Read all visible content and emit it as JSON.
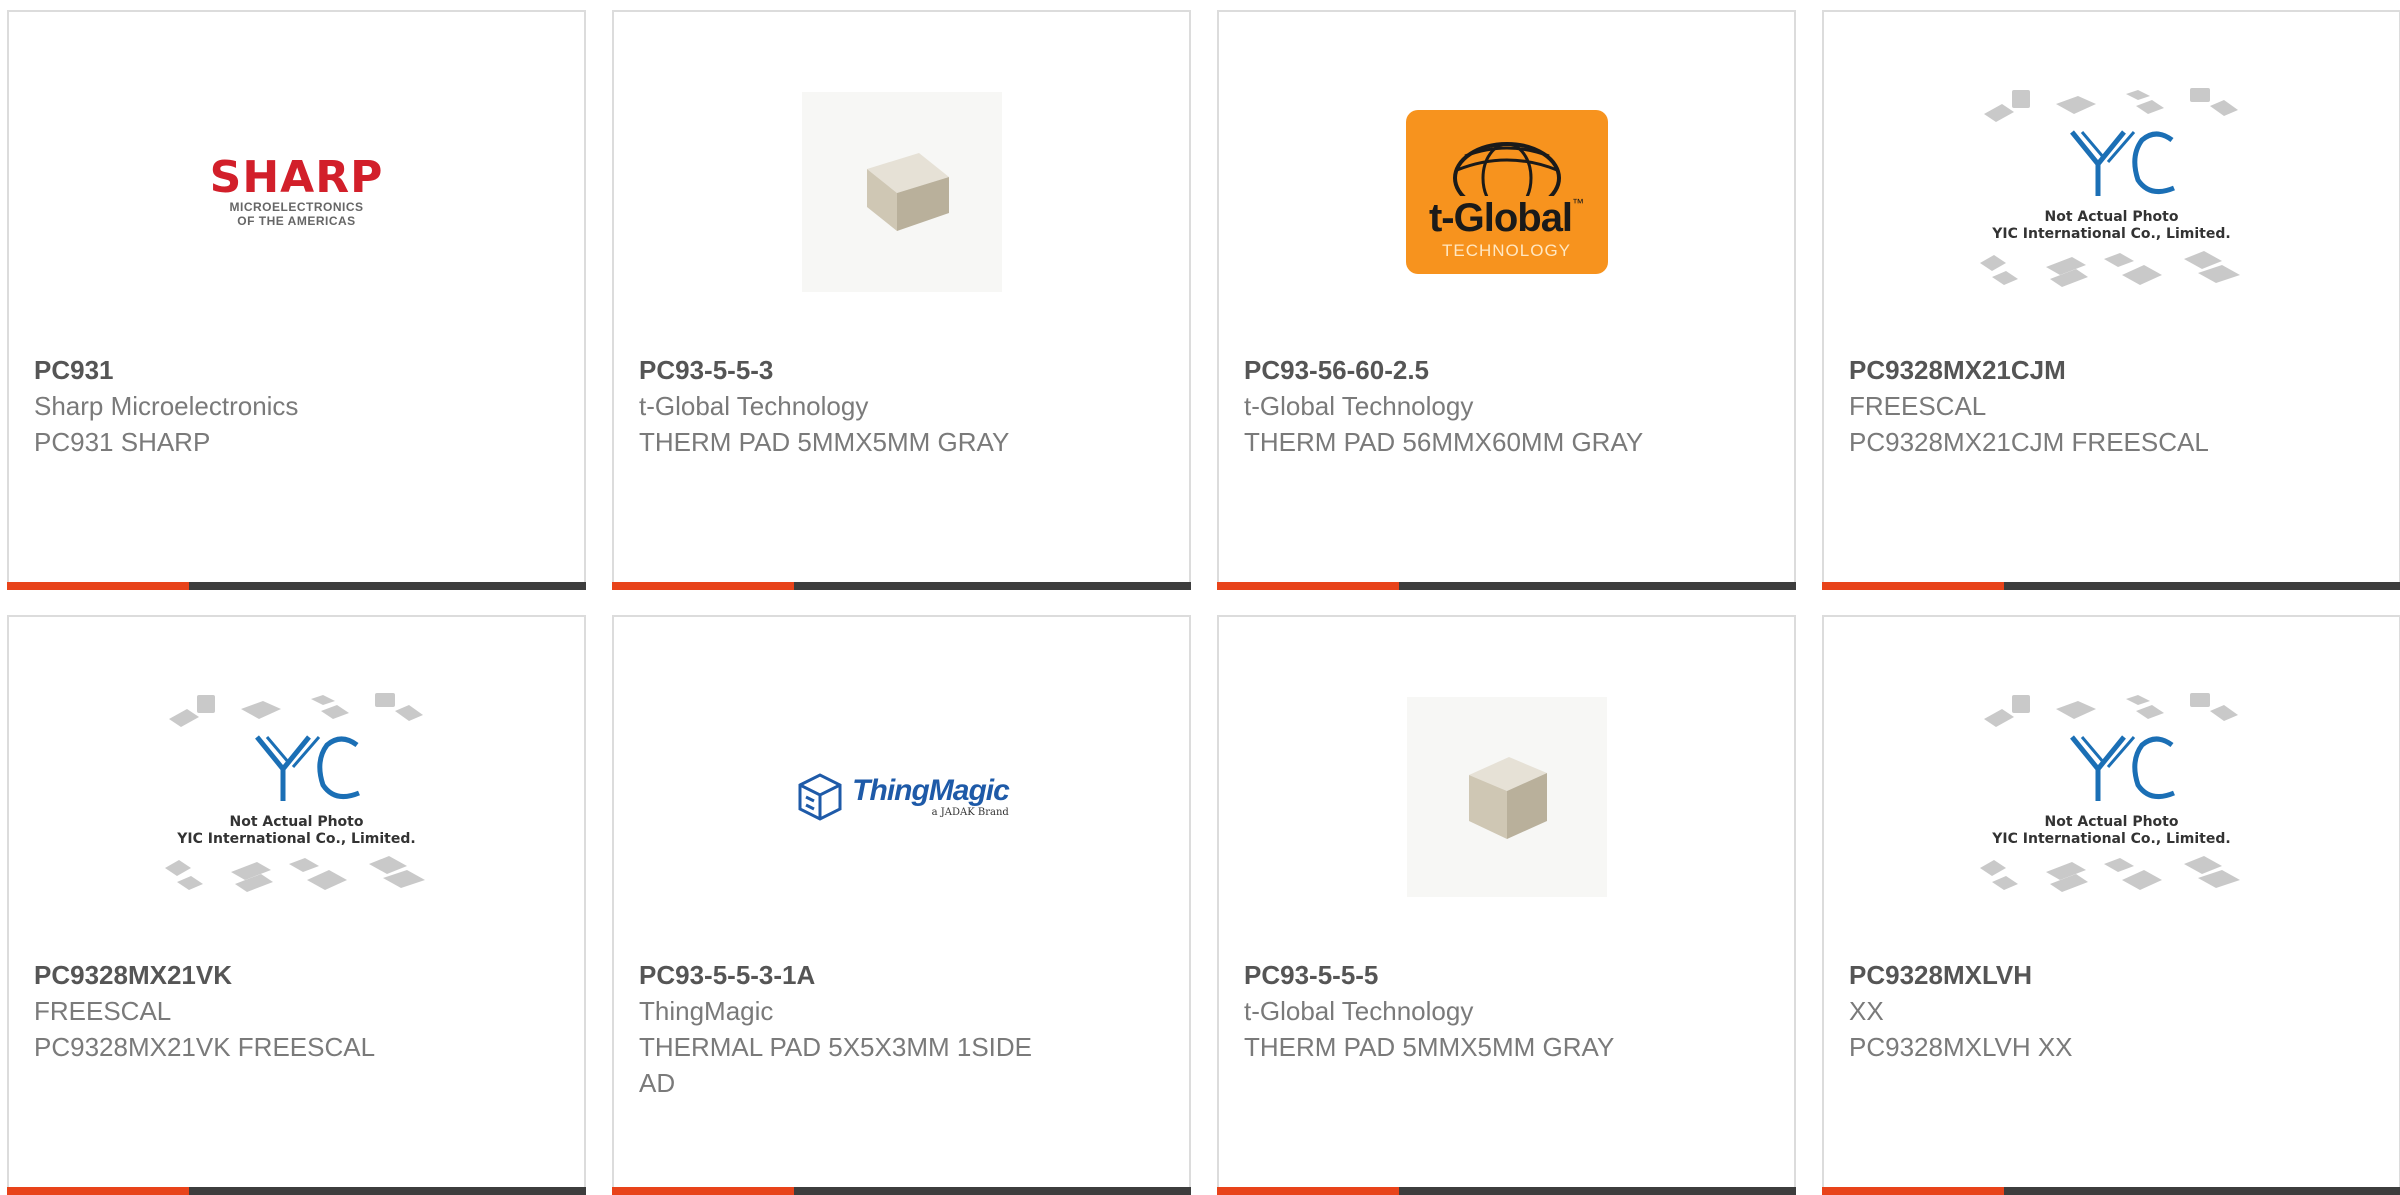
{
  "products": [
    {
      "part_number": "PC931",
      "manufacturer": "Sharp Microelectronics",
      "description": "PC931 SHARP",
      "image": "sharp-logo",
      "logo_text": "SHARP",
      "logo_subtext": "MICROELECTRONICS",
      "logo_subtext2": "OF THE AMERICAS"
    },
    {
      "part_number": "PC93-5-5-3",
      "manufacturer": "t-Global Technology",
      "description": "THERM PAD 5MMX5MM GRAY",
      "image": "thermal-pad-photo"
    },
    {
      "part_number": "PC93-56-60-2.5",
      "manufacturer": "t-Global Technology",
      "description": "THERM PAD 56MMX60MM GRAY",
      "image": "tglobal-logo",
      "logo_text": "t-Global",
      "logo_tm": "™",
      "logo_subtext": "TECHNOLOGY"
    },
    {
      "part_number": "PC9328MX21CJM",
      "manufacturer": "FREESCAL",
      "description": "PC9328MX21CJM FREESCAL",
      "image": "yic-placeholder",
      "note_line1": "Not Actual Photo",
      "note_line2": "YIC International Co., Limited."
    },
    {
      "part_number": "PC9328MX21VK",
      "manufacturer": "FREESCAL",
      "description": "PC9328MX21VK FREESCAL",
      "image": "yic-placeholder",
      "note_line1": "Not Actual Photo",
      "note_line2": "YIC International Co., Limited."
    },
    {
      "part_number": "PC93-5-5-3-1A",
      "manufacturer": "ThingMagic",
      "description": "THERMAL PAD 5X5X3MM 1SIDE AD",
      "image": "thingmagic-logo",
      "logo_text": "ThingMagic",
      "logo_subtext": "a JADAK Brand"
    },
    {
      "part_number": "PC93-5-5-5",
      "manufacturer": "t-Global Technology",
      "description": "THERM PAD 5MMX5MM GRAY",
      "image": "thermal-pad-photo"
    },
    {
      "part_number": "PC9328MXLVH",
      "manufacturer": "XX",
      "description": "PC9328MXLVH XX",
      "image": "yic-placeholder",
      "note_line1": "Not Actual Photo",
      "note_line2": "YIC International Co., Limited."
    }
  ],
  "colors": {
    "accent": "#e8431a",
    "bar": "#3d3d3d",
    "border": "#dcdcdc",
    "part_number": "#555555",
    "text": "#7a7a7a"
  }
}
